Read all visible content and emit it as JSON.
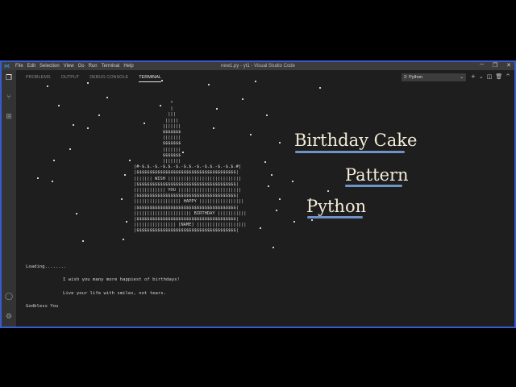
{
  "window": {
    "title": "new1.py - yt1 - Visual Studio Code",
    "menu": [
      "File",
      "Edit",
      "Selection",
      "View",
      "Go",
      "Run",
      "Terminal",
      "Help"
    ],
    "controls": [
      "─",
      "❐",
      "✕"
    ]
  },
  "panel": {
    "tabs": [
      "PROBLEMS",
      "OUTPUT",
      "DEBUG CONSOLE",
      "TERMINAL"
    ],
    "active_tab": "TERMINAL",
    "terminal_selector": "2: Python",
    "actions": [
      "+",
      "⌄",
      "◫",
      "🗑",
      "^",
      "✕"
    ]
  },
  "activity_icons": [
    "explorer-icon",
    "source-control-icon",
    "extensions-icon",
    "account-icon",
    "gear-icon"
  ],
  "terminal": {
    "cake_lines": [
      "              *",
      "              |",
      "             |||",
      "            |||||",
      "           |||||||",
      "           $$$$$$$",
      "           |||||||",
      "           $$$$$$$",
      "           |||||||",
      "           $$$$$$$",
      "           |||||||",
      "|#-$.$.-$.-$.$.-$.-$.$.-$.-$.$.-$.-$.$.#|",
      "|$$$$$$$$$$$$$$$$$$$$$$$$$$$$$$$$$$$$$$|",
      "||||||| WISH ||||||||||||||||||||||||||||",
      "|$$$$$$$$$$$$$$$$$$$$$$$$$$$$$$$$$$$$$$|",
      "|||||||||||| YOU ||||||||||||||||||||||||",
      "|$$$$$$$$$$$$$$$$$$$$$$$$$$$$$$$$$$$$$$|",
      "|||||||||||||||||| HAPPY |||||||||||||||||",
      "|$$$$$$$$$$$$$$$$$$$$$$$$$$$$$$$$$$$$$$|",
      "|||||||||||||||||||||| BIRTHDAY |||||||||||",
      "|$$$$$$$$$$$$$$$$$$$$$$$$$$$$$$$$$$$$$$|",
      "|||||||||||||||| [NAME] |||||||||||||||||||",
      "|$$$$$$$$$$$$$$$$$$$$$$$$$$$$$$$$$$$$$$|"
    ],
    "loading": "Loading........",
    "wish": "I wish you many more happiest of birthdays!",
    "live": "Live your life with smiles, not tears.",
    "godbless": "Godbless You"
  },
  "overlay": {
    "line1": "Birthday Cake",
    "line2": "Pattern",
    "line3": "Python",
    "color": "#f2ecd8",
    "underline_color": "#6f93c6"
  },
  "colors": {
    "vscode_blue": "#3a5bd0",
    "terminal_bg": "#1e1e1e",
    "titlebar_bg": "#3c3c3c"
  }
}
